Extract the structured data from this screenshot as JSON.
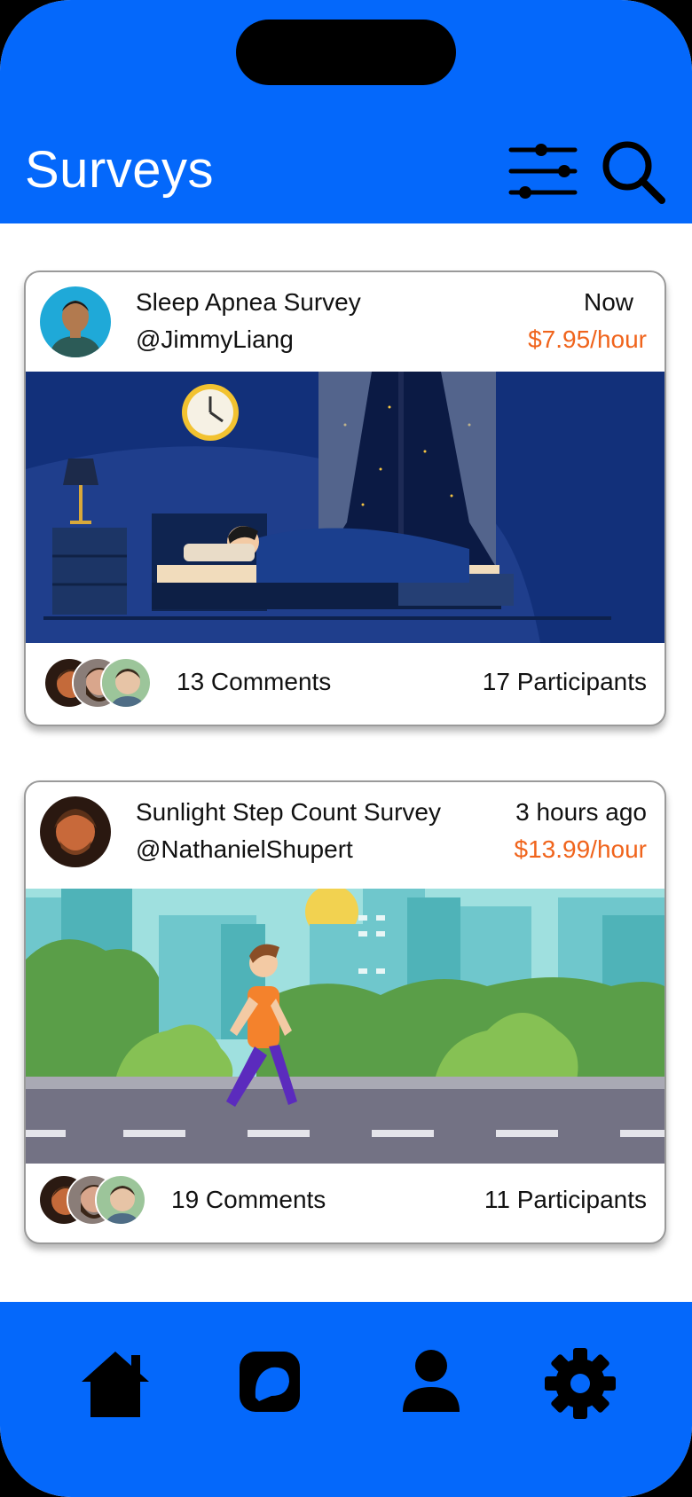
{
  "header": {
    "title": "Surveys"
  },
  "surveys": [
    {
      "title": "Sleep Apnea Survey",
      "user": "@JimmyLiang",
      "time": "Now",
      "pay": "$7.95/hour",
      "comments": "13 Comments",
      "participants": "17 Participants"
    },
    {
      "title": "Sunlight Step Count Survey",
      "user": "@NathanielShupert",
      "time": "3 hours ago",
      "pay": "$13.99/hour",
      "comments": "19 Comments",
      "participants": "11 Participants"
    }
  ],
  "bottom_nav": [
    "home-icon",
    "chat-icon",
    "profile-icon",
    "settings-icon"
  ],
  "colors": {
    "brand": "#0468fb",
    "pay": "#f0641c"
  }
}
